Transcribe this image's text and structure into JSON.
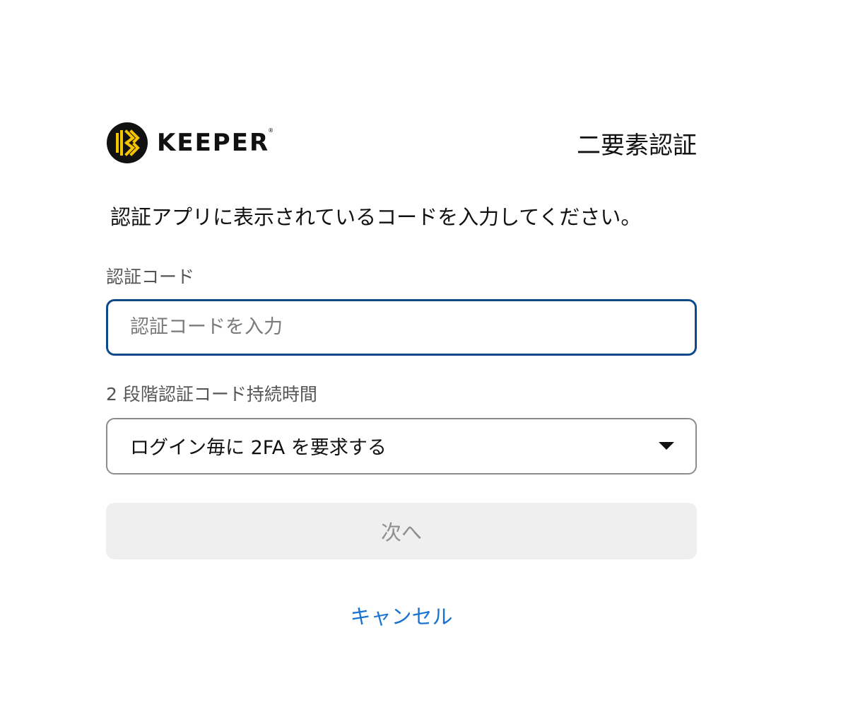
{
  "brand": {
    "logo_icon": "keeper-logo-icon",
    "name": "KEEPER",
    "registered_mark": "®",
    "accent_color": "#f5c400"
  },
  "header": {
    "title": "二要素認証"
  },
  "instruction": "認証アプリに表示されているコードを入力してください。",
  "code_field": {
    "label": "認証コード",
    "value": "",
    "placeholder": "認証コードを入力",
    "border_color": "#0e4a8a"
  },
  "duration_field": {
    "label": "2 段階認証コード持続時間",
    "selected": "ログイン毎に 2FA を要求する",
    "icon": "caret-down-icon"
  },
  "next_button": {
    "label": "次へ",
    "enabled": false
  },
  "cancel_link": {
    "label": "キャンセル",
    "color": "#1a73d0"
  }
}
